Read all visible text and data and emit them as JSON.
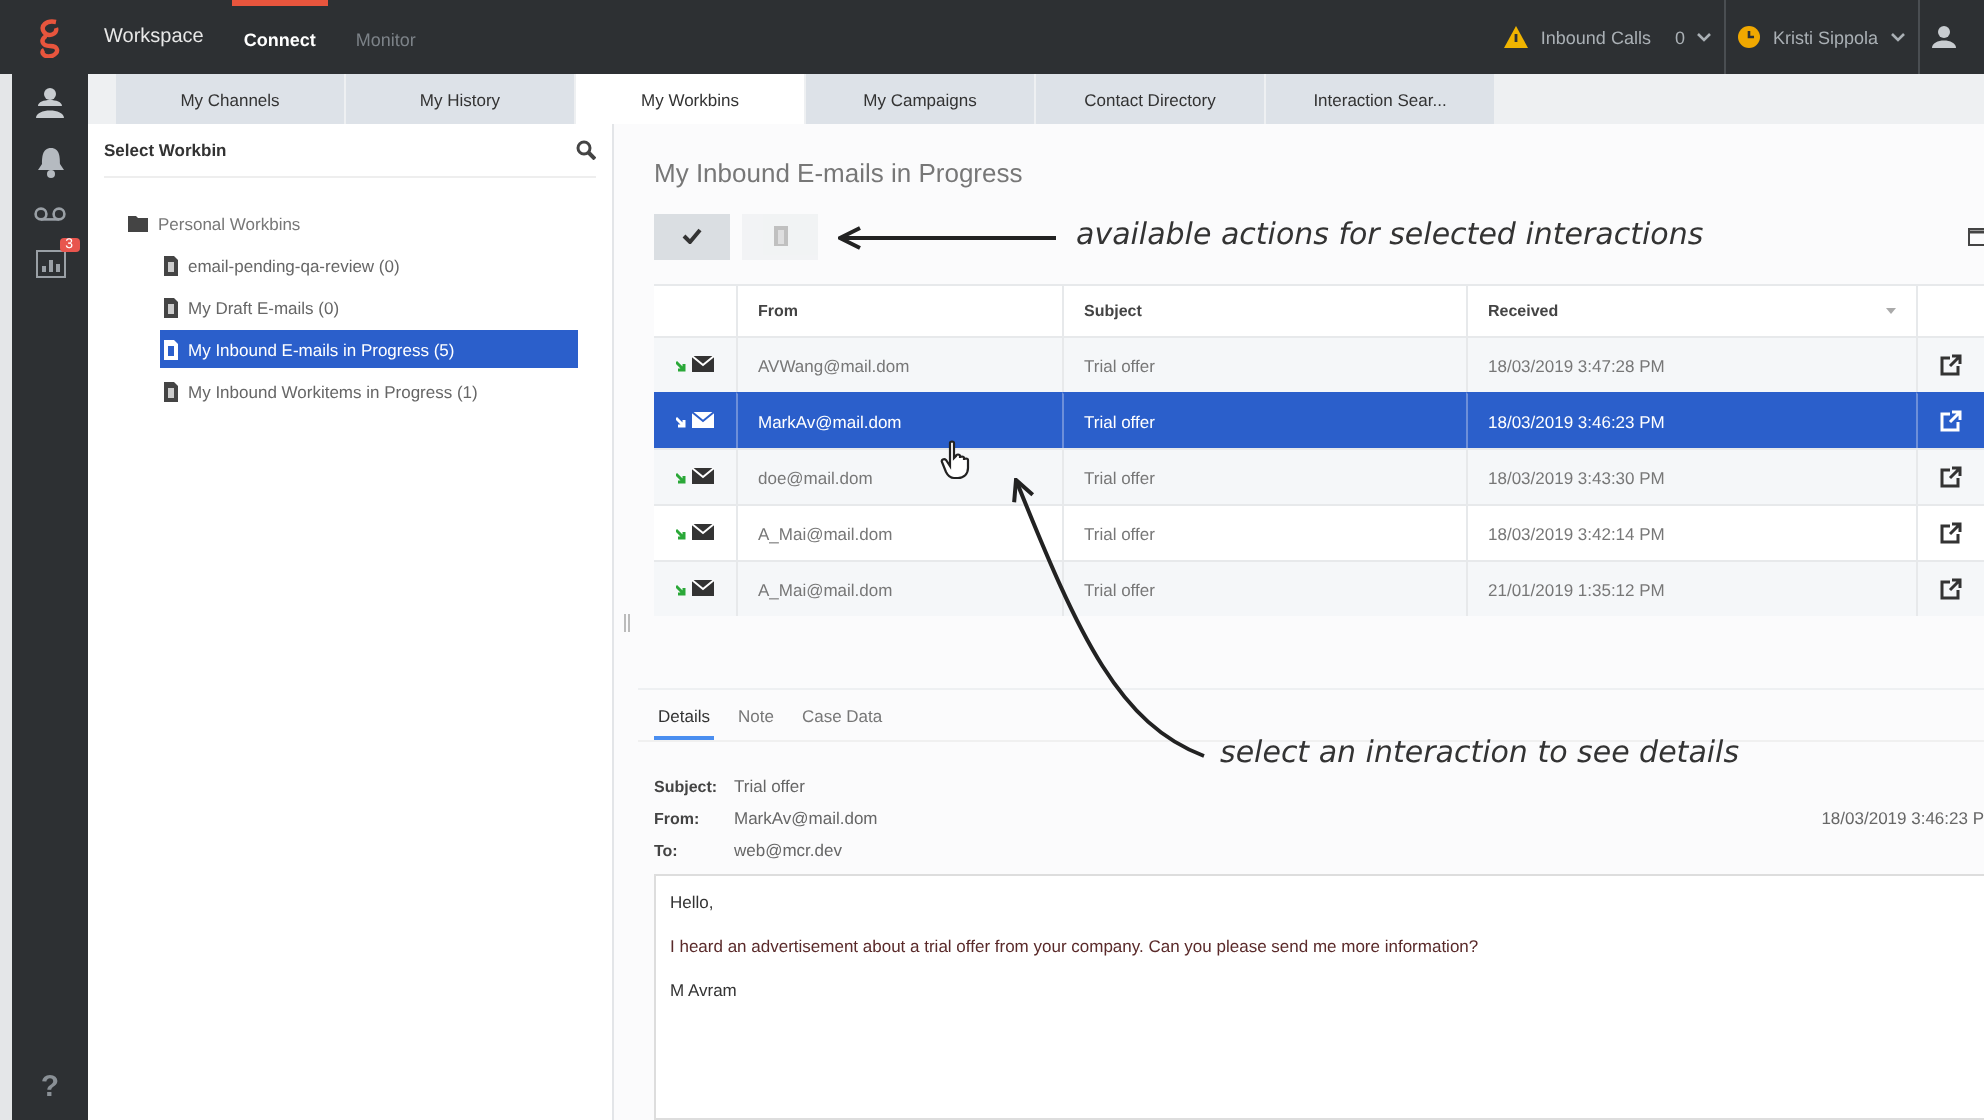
{
  "topbar": {
    "app": "Workspace",
    "nav": [
      {
        "label": "Connect",
        "selected": true
      },
      {
        "label": "Monitor",
        "selected": false
      }
    ],
    "queue": {
      "label": "Inbound Calls",
      "count": "0"
    },
    "user": {
      "name": "Kristi Sippola"
    }
  },
  "sidebar": {
    "badge": "3",
    "help": "?"
  },
  "tabs": [
    {
      "label": "My Channels",
      "selected": false
    },
    {
      "label": "My History",
      "selected": false
    },
    {
      "label": "My Workbins",
      "selected": true
    },
    {
      "label": "My Campaigns",
      "selected": false
    },
    {
      "label": "Contact Directory",
      "selected": false
    },
    {
      "label": "Interaction Sear...",
      "selected": false
    }
  ],
  "workbins": {
    "title": "Select Workbin",
    "tree": [
      {
        "label": "Personal Workbins",
        "children": [
          {
            "label": "email-pending-qa-review (0)",
            "selected": false
          },
          {
            "label": "My Draft E-mails (0)",
            "selected": false
          },
          {
            "label": "My Inbound E-mails in Progress (5)",
            "selected": true
          },
          {
            "label": "My Inbound Workitems in Progress (1)",
            "selected": false
          }
        ]
      }
    ]
  },
  "workbin_view": {
    "title": "My Inbound E-mails in Progress",
    "actions": [
      {
        "kind": "done",
        "disabled": false
      },
      {
        "kind": "delete",
        "disabled": true
      }
    ],
    "table": {
      "columns": [
        "From",
        "Subject",
        "Received"
      ],
      "rows": [
        {
          "from": "AVWang@mail.dom",
          "subject": "Trial offer",
          "received": "18/03/2019 3:47:28 PM",
          "selected": false
        },
        {
          "from": "MarkAv@mail.dom",
          "subject": "Trial offer",
          "received": "18/03/2019 3:46:23 PM",
          "selected": true
        },
        {
          "from": "doe@mail.dom",
          "subject": "Trial offer",
          "received": "18/03/2019 3:43:30 PM",
          "selected": false
        },
        {
          "from": "A_Mai@mail.dom",
          "subject": "Trial offer",
          "received": "18/03/2019 3:42:14 PM",
          "selected": false
        },
        {
          "from": "A_Mai@mail.dom",
          "subject": "Trial offer",
          "received": "21/01/2019 1:35:12 PM",
          "selected": false
        }
      ]
    }
  },
  "details": {
    "tabs": [
      {
        "label": "Details",
        "selected": true
      },
      {
        "label": "Note",
        "selected": false
      },
      {
        "label": "Case Data",
        "selected": false
      }
    ],
    "fields": [
      {
        "label": "Subject:",
        "value": "Trial offer"
      },
      {
        "label": "From:",
        "value": "MarkAv@mail.dom"
      },
      {
        "label": "To:",
        "value": "web@mcr.dev"
      }
    ],
    "date": "18/03/2019 3:46:23 P",
    "body": [
      "Hello,",
      "I heard an advertisement about a trial offer from your company. Can you please send me more information?",
      "M Avram"
    ]
  },
  "annotations": [
    {
      "text": "available actions for selected interactions"
    },
    {
      "text": "select an interaction to see details"
    }
  ]
}
